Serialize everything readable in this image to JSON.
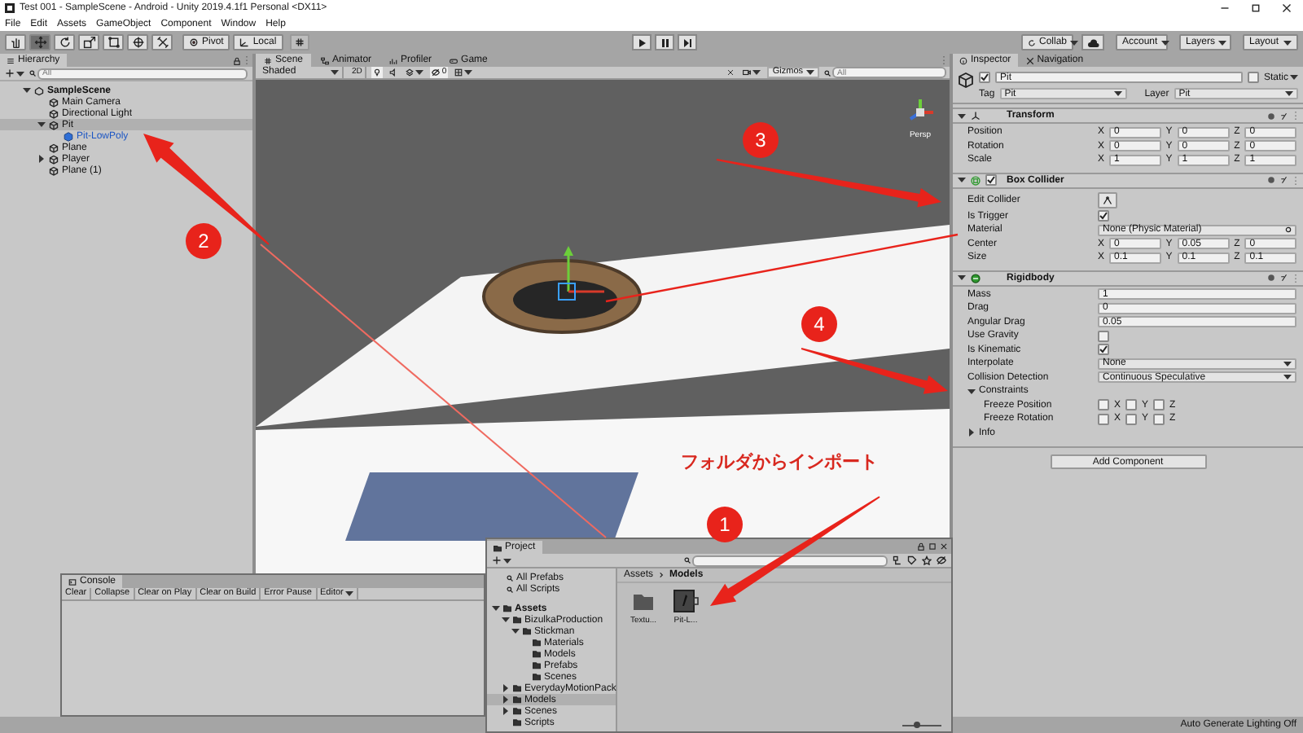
{
  "window": {
    "title": "Test 001 - SampleScene - Android - Unity 2019.4.1f1 Personal <DX11>"
  },
  "menu": [
    "File",
    "Edit",
    "Assets",
    "GameObject",
    "Component",
    "Window",
    "Help"
  ],
  "toolbar": {
    "tools": [
      {
        "kind": "hand",
        "selected": false
      },
      {
        "kind": "move",
        "selected": true
      },
      {
        "kind": "rotate",
        "selected": false
      },
      {
        "kind": "scale",
        "selected": false
      },
      {
        "kind": "rect",
        "selected": false
      },
      {
        "kind": "transform",
        "selected": false
      },
      {
        "kind": "custom",
        "selected": false
      }
    ],
    "pivot": "Pivot",
    "space": "Local",
    "collab": "Collab",
    "account": "Account",
    "layers": "Layers",
    "layout": "Layout"
  },
  "hierarchy": {
    "title": "Hierarchy",
    "search_placeholder": "All",
    "tree": [
      {
        "label": "SampleScene",
        "kind": "scene",
        "expanded": true,
        "selected": false,
        "children": [
          {
            "label": "Main Camera",
            "kind": "object",
            "selected": false
          },
          {
            "label": "Directional Light",
            "kind": "object",
            "selected": false
          },
          {
            "label": "Pit",
            "kind": "object",
            "expanded": true,
            "selected": true,
            "children": [
              {
                "label": "Pit-LowPoly",
                "kind": "prefab",
                "selected": false
              }
            ]
          },
          {
            "label": "Plane",
            "kind": "object",
            "selected": false
          },
          {
            "label": "Player",
            "kind": "object",
            "expanded": false,
            "selected": false
          },
          {
            "label": "Plane (1)",
            "kind": "object",
            "selected": false
          }
        ]
      }
    ]
  },
  "scene": {
    "tabs": [
      {
        "label": "Scene",
        "kind": "scene",
        "selected": true
      },
      {
        "label": "Animator",
        "kind": "animator",
        "selected": false
      },
      {
        "label": "Profiler",
        "kind": "profiler",
        "selected": false
      },
      {
        "label": "Game",
        "kind": "game",
        "selected": false
      }
    ],
    "draw_mode": "Shaded",
    "mode_2d": "2D",
    "hidden_count": "0",
    "gizmos": "Gizmos",
    "search_placeholder": "All",
    "view_label": "Persp"
  },
  "inspector": {
    "tabs": [
      {
        "label": "Inspector",
        "selected": true
      },
      {
        "label": "Navigation",
        "selected": false
      }
    ],
    "object": {
      "name": "Pit",
      "active": true,
      "static_label": "Static",
      "static": false,
      "tag_label": "Tag",
      "tag": "Pit",
      "layer_label": "Layer",
      "layer": "Pit"
    },
    "components": [
      {
        "title": "Transform",
        "kind": "transform",
        "rows": [
          {
            "label": "Position",
            "kind": "vector3",
            "values": [
              {
                "axis": "X",
                "value": "0"
              },
              {
                "axis": "Y",
                "value": "0"
              },
              {
                "axis": "Z",
                "value": "0"
              }
            ]
          },
          {
            "label": "Rotation",
            "kind": "vector3",
            "values": [
              {
                "axis": "X",
                "value": "0"
              },
              {
                "axis": "Y",
                "value": "0"
              },
              {
                "axis": "Z",
                "value": "0"
              }
            ]
          },
          {
            "label": "Scale",
            "kind": "vector3",
            "values": [
              {
                "axis": "X",
                "value": "1"
              },
              {
                "axis": "Y",
                "value": "1"
              },
              {
                "axis": "Z",
                "value": "1"
              }
            ]
          }
        ]
      },
      {
        "title": "Box Collider",
        "kind": "box_collider",
        "enabled": true,
        "rows": [
          {
            "label": "Edit Collider",
            "kind": "button"
          },
          {
            "label": "Is Trigger",
            "kind": "checkbox",
            "checked": true
          },
          {
            "label": "Material",
            "kind": "object",
            "value": "None (Physic Material)"
          },
          {
            "label": "Center",
            "kind": "vector3",
            "values": [
              {
                "axis": "X",
                "value": "0"
              },
              {
                "axis": "Y",
                "value": "0.05"
              },
              {
                "axis": "Z",
                "value": "0"
              }
            ]
          },
          {
            "label": "Size",
            "kind": "vector3",
            "values": [
              {
                "axis": "X",
                "value": "0.1"
              },
              {
                "axis": "Y",
                "value": "0.1"
              },
              {
                "axis": "Z",
                "value": "0.1"
              }
            ]
          }
        ]
      },
      {
        "title": "Rigidbody",
        "kind": "rigidbody",
        "rows": [
          {
            "label": "Mass",
            "kind": "number",
            "value": "1"
          },
          {
            "label": "Drag",
            "kind": "number",
            "value": "0"
          },
          {
            "label": "Angular Drag",
            "kind": "number",
            "value": "0.05"
          },
          {
            "label": "Use Gravity",
            "kind": "checkbox",
            "checked": false
          },
          {
            "label": "Is Kinematic",
            "kind": "checkbox",
            "checked": true
          },
          {
            "label": "Interpolate",
            "kind": "dropdown",
            "value": "None"
          },
          {
            "label": "Collision Detection",
            "kind": "dropdown",
            "value": "Continuous Speculative"
          },
          {
            "label": "Constraints",
            "kind": "foldout",
            "expanded": true,
            "children": [
              {
                "label": "Freeze Position",
                "kind": "axis_checks",
                "values": [
                  {
                    "axis": "X",
                    "checked": false
                  },
                  {
                    "axis": "Y",
                    "checked": false
                  },
                  {
                    "axis": "Z",
                    "checked": false
                  }
                ]
              },
              {
                "label": "Freeze Rotation",
                "kind": "axis_checks",
                "values": [
                  {
                    "axis": "X",
                    "checked": false
                  },
                  {
                    "axis": "Y",
                    "checked": false
                  },
                  {
                    "axis": "Z",
                    "checked": false
                  }
                ]
              }
            ]
          },
          {
            "label": "Info",
            "kind": "foldout",
            "expanded": false
          }
        ]
      }
    ],
    "add_component": "Add Component"
  },
  "console": {
    "title": "Console",
    "buttons": [
      {
        "label": "Clear",
        "kind": "button"
      },
      {
        "label": "Collapse",
        "kind": "button"
      },
      {
        "label": "Clear on Play",
        "kind": "button"
      },
      {
        "label": "Clear on Build",
        "kind": "button"
      },
      {
        "label": "Error Pause",
        "kind": "button"
      },
      {
        "label": "Editor",
        "kind": "dropdown"
      }
    ]
  },
  "project": {
    "title": "Project",
    "favorites": [
      "All Prefabs",
      "All Scripts"
    ],
    "tree": [
      {
        "label": "Assets",
        "expanded": true,
        "selected": false,
        "children": [
          {
            "label": "BizulkaProduction",
            "expanded": true,
            "selected": false,
            "children": [
              {
                "label": "Stickman",
                "expanded": true,
                "selected": false,
                "children": [
                  {
                    "label": "Materials",
                    "selected": false
                  },
                  {
                    "label": "Models",
                    "selected": false
                  },
                  {
                    "label": "Prefabs",
                    "selected": false
                  },
                  {
                    "label": "Scenes",
                    "selected": false
                  }
                ]
              }
            ]
          },
          {
            "label": "EverydayMotionPack",
            "expanded": false,
            "selected": false
          },
          {
            "label": "Models",
            "expanded": false,
            "selected": true
          },
          {
            "label": "Scenes",
            "expanded": false,
            "selected": false
          },
          {
            "label": "Scripts",
            "selected": false
          }
        ]
      }
    ],
    "breadcrumb": [
      "Assets",
      "Models"
    ],
    "assets": [
      {
        "label": "Textu...",
        "kind": "folder"
      },
      {
        "label": "Pit-L...",
        "kind": "model"
      }
    ],
    "zoom_slider": {
      "level": 0.35
    }
  },
  "status_bar": {
    "text": "Auto Generate Lighting Off"
  },
  "annotations": {
    "markers": [
      "1",
      "2",
      "3",
      "4"
    ],
    "callout": "フォルダからインポート"
  }
}
